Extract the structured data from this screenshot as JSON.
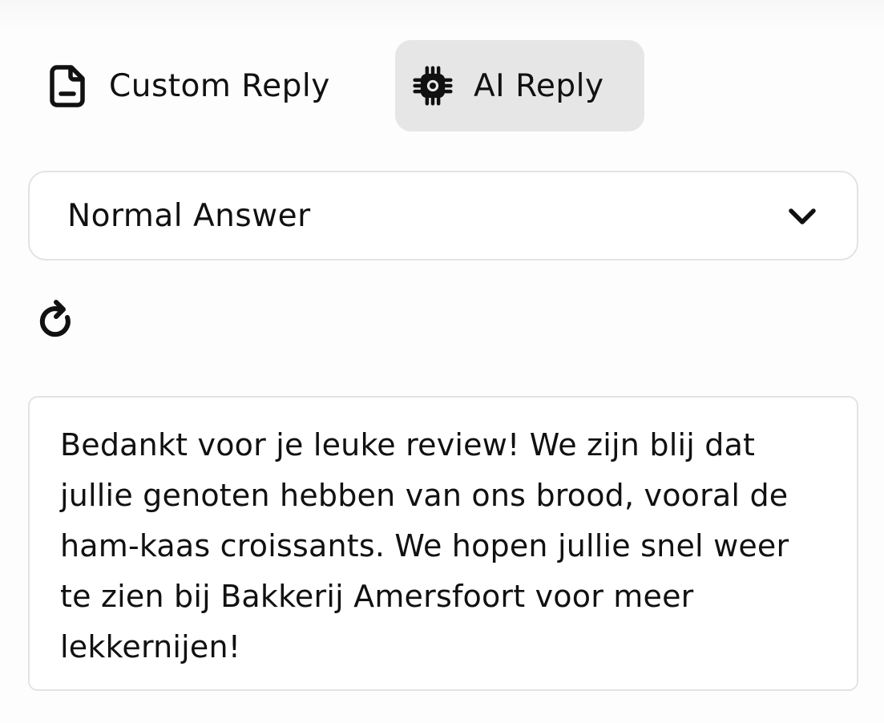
{
  "tabs": {
    "custom": {
      "label": "Custom Reply",
      "icon": "document-icon"
    },
    "ai": {
      "label": "AI Reply",
      "icon": "chip-icon",
      "active": true
    }
  },
  "answer_type": {
    "selected": "Normal Answer",
    "icon": "chevron-down-icon"
  },
  "refresh": {
    "icon": "refresh-icon"
  },
  "reply": {
    "text": "Bedankt voor je leuke review! We zijn blij dat jullie genoten hebben van ons brood, vooral de ham-kaas croissants. We hopen jullie snel weer te zien bij Bakkerij Amersfoort voor meer lekkernijen!"
  },
  "colors": {
    "active_tab_bg": "#e6e6e6",
    "border": "#e3e3e3",
    "text": "#111111"
  }
}
